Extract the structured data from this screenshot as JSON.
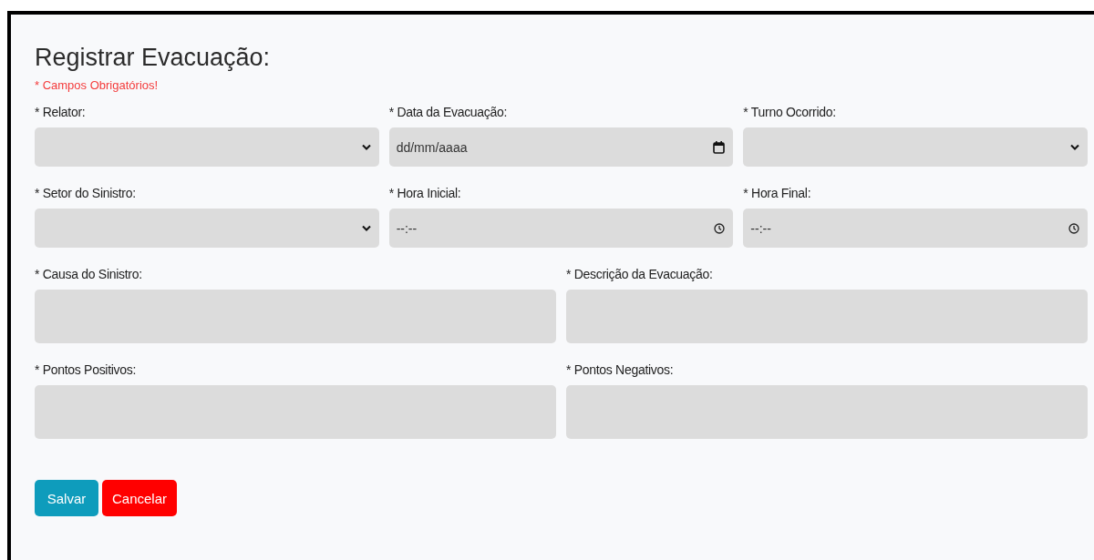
{
  "form": {
    "title": "Registrar Evacuação:",
    "required_note": "* Campos Obrigatórios!",
    "rows": [
      {
        "fields": [
          {
            "label": "* Relator:",
            "kind": "select"
          },
          {
            "label": "* Data da Evacuação:",
            "kind": "date",
            "placeholder": "dd/mm/aaaa"
          },
          {
            "label": "* Turno Ocorrido:",
            "kind": "select"
          }
        ]
      },
      {
        "fields": [
          {
            "label": "* Setor do Sinistro:",
            "kind": "select"
          },
          {
            "label": "* Hora Inicial:",
            "kind": "time",
            "placeholder": "--:--"
          },
          {
            "label": "* Hora Final:",
            "kind": "time",
            "placeholder": "--:--"
          }
        ]
      },
      {
        "fields": [
          {
            "label": "* Causa do Sinistro:",
            "kind": "textarea"
          },
          {
            "label": "* Descrição da Evacuação:",
            "kind": "textarea"
          }
        ]
      },
      {
        "fields": [
          {
            "label": "* Pontos Positivos:",
            "kind": "textarea"
          },
          {
            "label": "* Pontos Negativos:",
            "kind": "textarea"
          }
        ]
      }
    ],
    "buttons": [
      {
        "label": "Salvar",
        "kind": "primary"
      },
      {
        "label": "Cancelar",
        "kind": "danger"
      }
    ]
  }
}
